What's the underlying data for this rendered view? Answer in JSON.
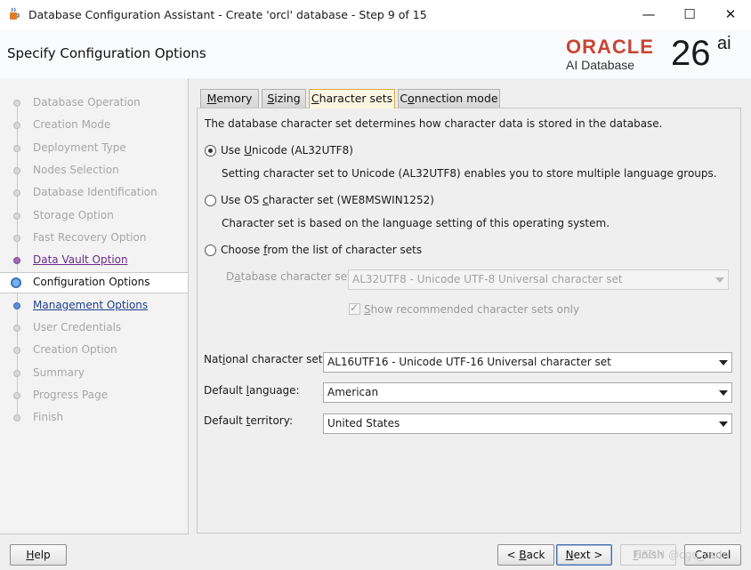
{
  "window": {
    "title": "Database Configuration Assistant - Create 'orcl' database - Step 9 of 15",
    "icon": "java-coffee-cup-icon",
    "controls": {
      "minimize": "—",
      "maximize": "☐",
      "close": "✕"
    }
  },
  "header": {
    "page_title": "Specify Configuration Options",
    "logo": {
      "brand": "ORACLE",
      "product": "AI Database",
      "version_number": "26",
      "version_suffix": "ai",
      "brand_color": "#c74634"
    }
  },
  "sidebar": {
    "items": [
      {
        "label": "Database Operation",
        "state": "disabled"
      },
      {
        "label": "Creation Mode",
        "state": "disabled"
      },
      {
        "label": "Deployment Type",
        "state": "disabled"
      },
      {
        "label": "Nodes Selection",
        "state": "disabled"
      },
      {
        "label": "Database Identification",
        "state": "disabled"
      },
      {
        "label": "Storage Option",
        "state": "disabled"
      },
      {
        "label": "Fast Recovery Option",
        "state": "disabled"
      },
      {
        "label": "Data Vault Option",
        "state": "visited"
      },
      {
        "label": "Configuration Options",
        "state": "current"
      },
      {
        "label": "Management Options",
        "state": "link"
      },
      {
        "label": "User Credentials",
        "state": "disabled"
      },
      {
        "label": "Creation Option",
        "state": "disabled"
      },
      {
        "label": "Summary",
        "state": "disabled"
      },
      {
        "label": "Progress Page",
        "state": "disabled"
      },
      {
        "label": "Finish",
        "state": "disabled"
      }
    ]
  },
  "tabs": [
    {
      "pre": "",
      "mn": "M",
      "post": "emory",
      "active": false
    },
    {
      "pre": "",
      "mn": "S",
      "post": "izing",
      "active": false
    },
    {
      "pre": "",
      "mn": "C",
      "post": "haracter sets",
      "active": true
    },
    {
      "pre": "C",
      "mn": "o",
      "post": "nnection mode",
      "active": false
    }
  ],
  "charset": {
    "intro": "The database character set determines how character data is stored in the database.",
    "option_unicode": {
      "pre": "Use ",
      "mn": "U",
      "post": "nicode (AL32UTF8)",
      "checked": true
    },
    "unicode_desc": "Setting character set to Unicode (AL32UTF8) enables you to store multiple language groups.",
    "option_os": {
      "pre": "Use OS ",
      "mn": "c",
      "post": "haracter set (WE8MSWIN1252)",
      "checked": false
    },
    "os_desc": "Character set is based on the language setting of this operating system.",
    "option_list": {
      "pre": "Choose ",
      "mn": "f",
      "post": "rom the list of character sets",
      "checked": false
    },
    "db_charset_label": {
      "pre": "D",
      "mn": "a",
      "post": "tabase character set:"
    },
    "db_charset_value": "AL32UTF8 - Unicode UTF-8 Universal character set",
    "show_recommended": {
      "pre": "",
      "mn": "S",
      "post": "how recommended character sets only",
      "checked": true
    },
    "national_label": {
      "pre": "Nat",
      "mn": "i",
      "post": "onal character set:"
    },
    "national_value": "AL16UTF16 - Unicode UTF-16 Universal character set",
    "language_label": {
      "pre": "Default ",
      "mn": "l",
      "post": "anguage:"
    },
    "language_value": "American",
    "territory_label": {
      "pre": "Default ",
      "mn": "t",
      "post": "erritory:"
    },
    "territory_value": "United States"
  },
  "buttons": {
    "help": {
      "pre": "",
      "mn": "H",
      "post": "elp"
    },
    "back": {
      "pre": "< ",
      "mn": "B",
      "post": "ack"
    },
    "next": {
      "pre": "",
      "mn": "N",
      "post": "ext >"
    },
    "finish": {
      "pre": "",
      "mn": "F",
      "post": "inish"
    },
    "cancel": {
      "pre": "Cancel",
      "mn": "",
      "post": ""
    }
  },
  "watermark": "CSDN @cgq_csdn"
}
